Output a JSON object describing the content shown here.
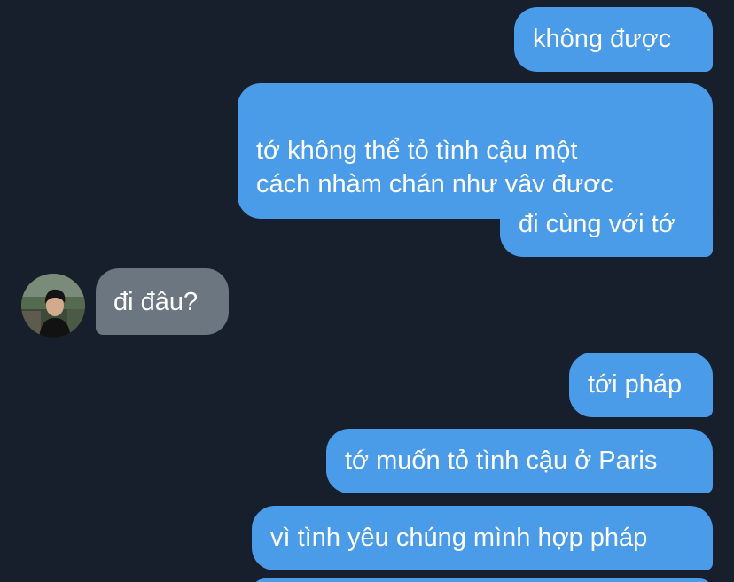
{
  "conversation": {
    "messages": [
      {
        "direction": "outgoing",
        "text": "không được"
      },
      {
        "direction": "outgoing",
        "text": "tớ không thể tỏ tình cậu một\ncách nhàm chán như vậy được"
      },
      {
        "direction": "outgoing",
        "text": "đi cùng với tớ"
      },
      {
        "direction": "incoming",
        "text": "đi đâu?"
      },
      {
        "direction": "outgoing",
        "text": "tới pháp"
      },
      {
        "direction": "outgoing",
        "text": "tớ muốn tỏ tình cậu ở Paris"
      },
      {
        "direction": "outgoing",
        "text": "vì tình yêu chúng mình hợp pháp"
      }
    ]
  },
  "colors": {
    "background": "#161f2b",
    "outgoing_bubble": "#4a9be8",
    "incoming_bubble": "#6b7681",
    "text": "#ffffff"
  },
  "icons": {
    "contact_avatar": "avatar-photo"
  }
}
